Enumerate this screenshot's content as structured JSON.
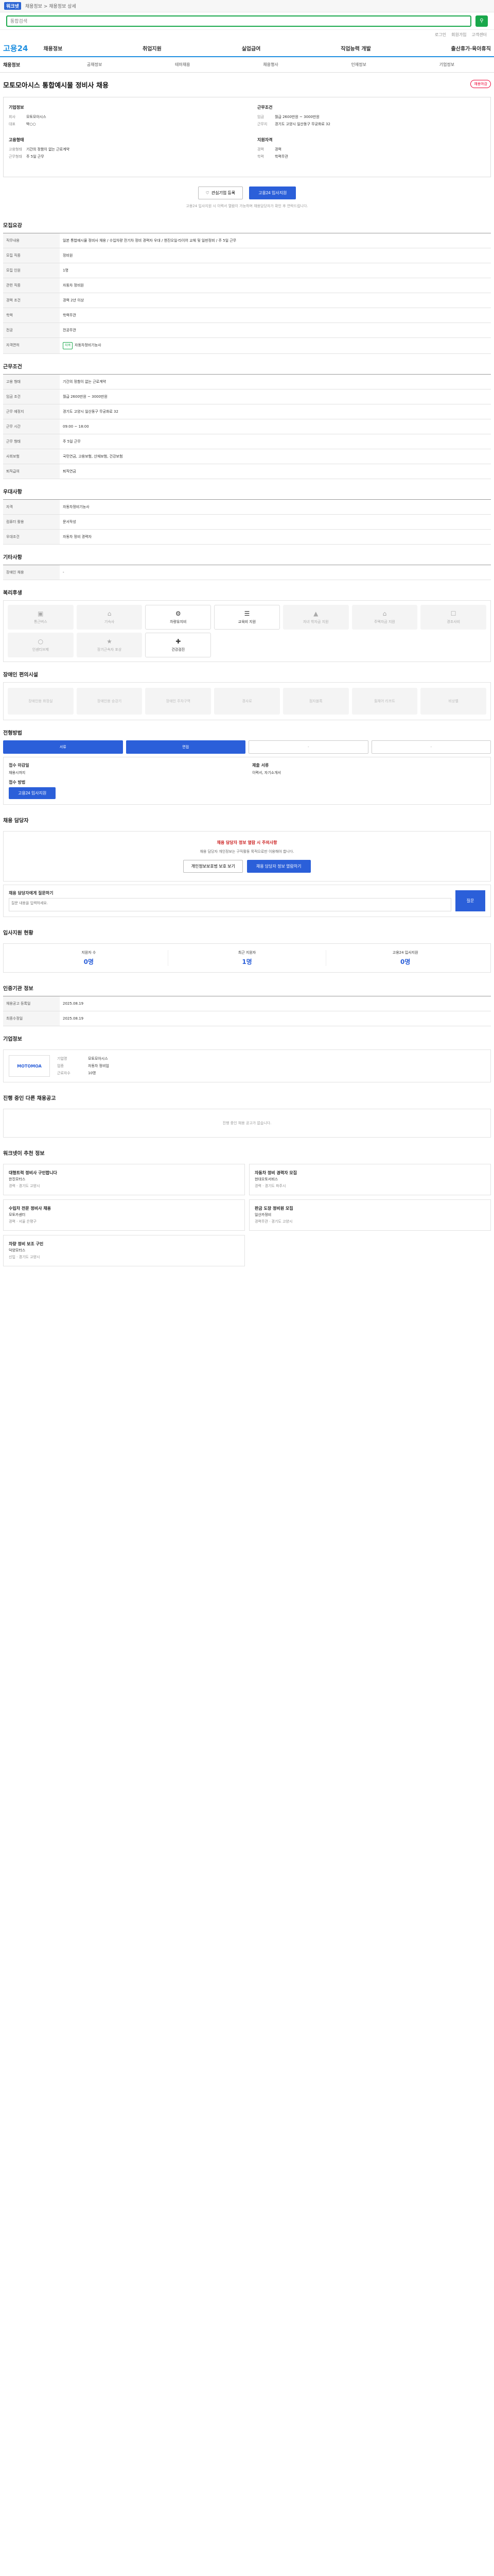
{
  "top": {
    "logo": "워크넷",
    "crumb": "채용정보 > 채용정보 상세"
  },
  "search": {
    "placeholder": "통합검색"
  },
  "util": [
    "로그인",
    "회원가입",
    "고객센터"
  ],
  "gnb": {
    "brand": "고용24",
    "menu": [
      "채용정보",
      "취업지원",
      "실업급여",
      "직업능력 개발",
      "출산휴가·육아휴직"
    ]
  },
  "subnav": {
    "title": "채용정보",
    "tabs": [
      "공채정보",
      "테마채용",
      "채용행사",
      "인재정보",
      "기업정보"
    ]
  },
  "job": {
    "title": "모토모아시스 통합예시물 정비사 채용",
    "badge": "채용마감"
  },
  "summary": {
    "company_h": "기업정보",
    "company": [
      [
        "회사",
        "모토모아시스"
      ],
      [
        "대표",
        "박○○"
      ]
    ],
    "cond_h": "근무조건",
    "cond": [
      [
        "임금",
        "월급 2600만원 ~ 3000만원"
      ],
      [
        "근무지",
        "경기도 고양시 일산동구 무궁화로 32"
      ]
    ],
    "emp_h": "고용형태",
    "emp": [
      [
        "고용형태",
        "기간의 정함이 없는 근로계약"
      ],
      [
        "근무형태",
        "주 5일 근무"
      ]
    ],
    "req_h": "지원자격",
    "req": [
      [
        "경력",
        "경력"
      ],
      [
        "학력",
        "학력무관"
      ]
    ]
  },
  "actions": {
    "fav": "관심기업 등록",
    "apply": "고용24 입사지원"
  },
  "notice": "고용24 입사지원 시 이력서 열람이 가능하며 채용담당자가 확인 후 연락드립니다.",
  "qual": {
    "title": "모집요강",
    "desc_h": "직무내용",
    "desc": "일본 통합예시물 정비사 채용 / 수입차량 전기차 정비 경력자 우대 / 엔진오일·타이어 교체 및 일반정비 / 주 5일 근무",
    "rows": [
      [
        "모집 직종",
        "정비원"
      ],
      [
        "모집 인원",
        "1명"
      ],
      [
        "관련 직종",
        "자동차 정비원"
      ],
      [
        "경력 조건",
        "경력 2년 이상"
      ],
      [
        "학력",
        "학력무관"
      ],
      [
        "전공",
        "전공무관"
      ],
      [
        "자격면허",
        "자동차정비기능사"
      ]
    ]
  },
  "work": {
    "title": "근무조건",
    "rows": [
      [
        "고용 형태",
        "기간의 정함이 없는 근로계약"
      ],
      [
        "임금 조건",
        "월급 2600만원 ~ 3000만원"
      ],
      [
        "근무 예정지",
        "경기도 고양시 일산동구 무궁화로 32"
      ],
      [
        "근무 시간",
        "09:00 ~ 18:00"
      ],
      [
        "근무 형태",
        "주 5일 근무"
      ],
      [
        "사회보험",
        "국민연금, 고용보험, 산재보험, 건강보험"
      ],
      [
        "퇴직급여",
        "퇴직연금"
      ]
    ]
  },
  "pref": {
    "title": "우대사항",
    "rows": [
      [
        "자격",
        "자동차정비기능사"
      ],
      [
        "컴퓨터 활용",
        "문서작성"
      ],
      [
        "우대조건",
        "자동차 정비 경력자"
      ]
    ]
  },
  "etc": {
    "title": "기타사항",
    "rows": [
      [
        "장애인 채용",
        "-"
      ]
    ]
  },
  "welfare": {
    "title": "복리후생",
    "items": [
      "통근버스",
      "기숙사",
      "차량유지비",
      "교육비 지원",
      "자녀 학자금 지원",
      "주택자금 지원",
      "경조사비",
      "인센티브제",
      "장기근속자 포상",
      "건강검진"
    ]
  },
  "facility": {
    "title": "장애인 편의시설",
    "items": [
      "장애인용 화장실",
      "장애인용 승강기",
      "장애인 주차구역",
      "경사로",
      "점자블록",
      "휠체어 리프트",
      "비상벨"
    ]
  },
  "process": {
    "title": "전형방법",
    "steps": [
      "서류",
      "면접",
      "-",
      "-"
    ],
    "deadline_h": "접수 마감일",
    "deadline": "채용시까지",
    "method_h": "접수 방법",
    "method": "고용24 입사지원",
    "docs_h": "제출 서류",
    "docs": "이력서, 자기소개서"
  },
  "contact": {
    "title": "채용 담당자",
    "warn": "채용 담당자 정보 열람 시 주의사항",
    "desc": "채용 담당자 개인정보는 구직활동 목적으로만 이용해야 합니다.",
    "btn1": "개인정보보호법 보호 보기",
    "btn2": "채용 담당자 정보 열람하기"
  },
  "inquiry": {
    "title": "채용 담당자에게 질문하기",
    "placeholder": "질문 내용을 입력하세요.",
    "send": "질문"
  },
  "stats": {
    "title": "입사지원 현황",
    "items": [
      {
        "label": "지원자 수",
        "num": "0명"
      },
      {
        "label": "최근 지원자",
        "num": "1명"
      },
      {
        "label": "고용24 입사지원",
        "num": "0명"
      }
    ]
  },
  "period": {
    "title": "인증기관 정보",
    "rows": [
      [
        "채용공고 등록일",
        "2025.08.19"
      ],
      [
        "최종수정일",
        "2025.08.19"
      ]
    ]
  },
  "company_info": {
    "title": "기업정보",
    "logo": "MOTOMOA",
    "rows": [
      [
        "기업명",
        "모토모아시스"
      ],
      [
        "업종",
        "자동차 정비업"
      ],
      [
        "근로자수",
        "10명"
      ]
    ]
  },
  "other": {
    "title": "진행 중인 다른 채용공고",
    "empty": "진행 중인 채용 공고가 없습니다."
  },
  "recommend": {
    "title": "워크넷이 추천 정보",
    "items": [
      {
        "title": "대형트럭 정비사 구인합니다",
        "co": "한진모터스",
        "meta": "경력 · 경기도 고양시"
      },
      {
        "title": "자동차 정비 경력자 모집",
        "co": "현대오토서비스",
        "meta": "경력 · 경기도 파주시"
      },
      {
        "title": "수입차 전문 정비사 채용",
        "co": "모토카센터",
        "meta": "경력 · 서울 은평구"
      },
      {
        "title": "판금 도장 정비원 모집",
        "co": "일산카정비",
        "meta": "경력무관 · 경기도 고양시"
      },
      {
        "title": "차량 정비 보조 구인",
        "co": "덕양모터스",
        "meta": "신입 · 경기도 고양시"
      }
    ]
  }
}
